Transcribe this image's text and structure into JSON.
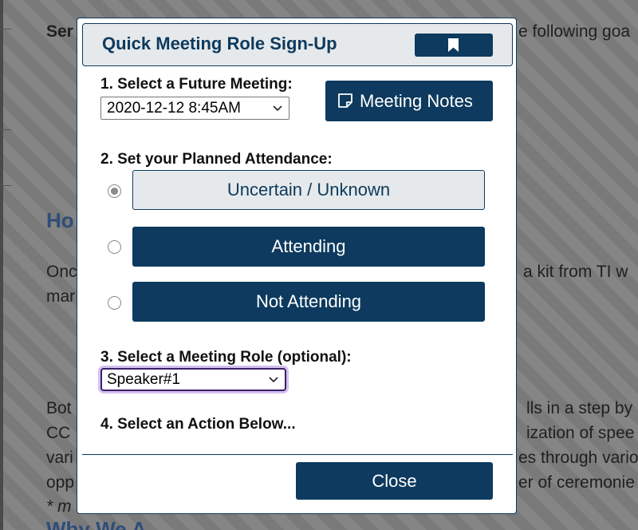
{
  "background": {
    "line1_left": "Ser",
    "line1_right": "e following goa",
    "heading": "Ho",
    "para1_left": "Onc",
    "para1_right": "a kit from TI w",
    "para1_line2": "mar",
    "para2_l1_left": "Bot",
    "para2_l1_right": "lls in a step by",
    "para2_l2_left": "CC",
    "para2_l2_right": "ization of spee",
    "para2_l3_left": "vari",
    "para2_l3_right": "es through vario",
    "para2_l4_left": "opp",
    "para2_l4_right": "er of ceremonie",
    "para2_l5_left": "* m",
    "bottom_heading": "Why We A"
  },
  "dialog": {
    "title": "Quick Meeting Role Sign-Up",
    "step1_label": "1. Select a Future Meeting:",
    "meeting_select_value": "2020-12-12 8:45AM",
    "notes_button_label": "Meeting Notes",
    "step2_label": "2. Set your Planned Attendance:",
    "attendance_options": [
      {
        "label": "Uncertain / Unknown",
        "selected": true
      },
      {
        "label": "Attending",
        "selected": false
      },
      {
        "label": "Not Attending",
        "selected": false
      }
    ],
    "step3_label": "3. Select a Meeting Role (optional):",
    "role_select_value": "Speaker#1",
    "step4_label": "4. Select an Action Below...",
    "close_label": "Close"
  },
  "icons": {
    "bookmark": "bookmark-icon",
    "notes": "sticky-note-icon",
    "dropdown": "chevron-down-icon"
  },
  "colors": {
    "accent": "#0d3a5e",
    "header_bg": "#e6e9eb",
    "backdrop": "#808080"
  }
}
